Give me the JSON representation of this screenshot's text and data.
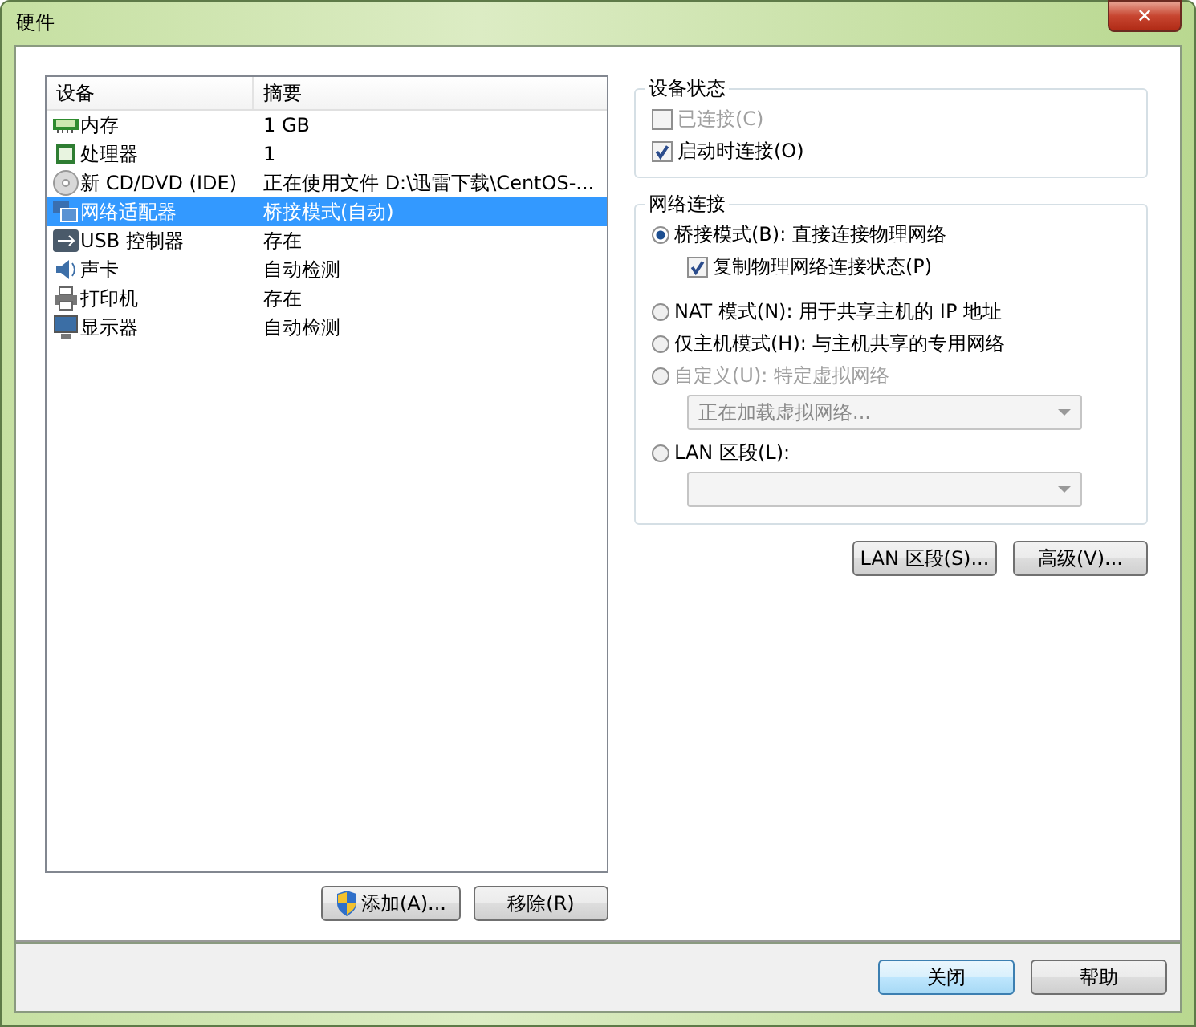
{
  "window": {
    "title": "硬件",
    "close_glyph": "✕"
  },
  "devices": {
    "columns": [
      "设备",
      "摘要"
    ],
    "rows": [
      {
        "kind": "memory",
        "name": "内存",
        "summary": "1 GB",
        "selected": false
      },
      {
        "kind": "cpu",
        "name": "处理器",
        "summary": "1",
        "selected": false
      },
      {
        "kind": "disc",
        "name": "新 CD/DVD (IDE)",
        "summary": "正在使用文件 D:\\迅雷下载\\CentOS-...",
        "selected": false
      },
      {
        "kind": "network",
        "name": "网络适配器",
        "summary": "桥接模式(自动)",
        "selected": true
      },
      {
        "kind": "usb",
        "name": "USB 控制器",
        "summary": "存在",
        "selected": false
      },
      {
        "kind": "sound",
        "name": "声卡",
        "summary": "自动检测",
        "selected": false
      },
      {
        "kind": "printer",
        "name": "打印机",
        "summary": "存在",
        "selected": false
      },
      {
        "kind": "display",
        "name": "显示器",
        "summary": "自动检测",
        "selected": false
      }
    ]
  },
  "add_button": "添加(A)...",
  "remove_button": "移除(R)",
  "device_status": {
    "title": "设备状态",
    "checkboxes": [
      {
        "label": "已连接(C)",
        "checked": false,
        "disabled": true
      },
      {
        "label": "启动时连接(O)",
        "checked": true,
        "disabled": false
      }
    ]
  },
  "network": {
    "title": "网络连接",
    "options": [
      {
        "kind": "radio",
        "label": "桥接模式(B): 直接连接物理网络",
        "selected": true,
        "disabled": false
      },
      {
        "kind": "checkbox",
        "label": "复制物理网络连接状态(P)",
        "checked": true
      },
      {
        "kind": "radio",
        "label": "NAT 模式(N): 用于共享主机的 IP 地址",
        "selected": false,
        "disabled": false
      },
      {
        "kind": "radio",
        "label": "仅主机模式(H): 与主机共享的专用网络",
        "selected": false,
        "disabled": false
      },
      {
        "kind": "radio",
        "label": "自定义(U): 特定虚拟网络",
        "selected": false,
        "disabled": true
      },
      {
        "kind": "select",
        "value": "正在加载虚拟网络...",
        "disabled": true
      },
      {
        "kind": "radio",
        "label": "LAN 区段(L):",
        "selected": false,
        "disabled": false
      },
      {
        "kind": "select",
        "disabled": true
      }
    ]
  },
  "lan_segments_button": "LAN 区段(S)...",
  "advanced_button": "高级(V)...",
  "footer_buttons": [
    {
      "label": "关闭",
      "default": true
    },
    {
      "label": "帮助",
      "default": false
    }
  ]
}
